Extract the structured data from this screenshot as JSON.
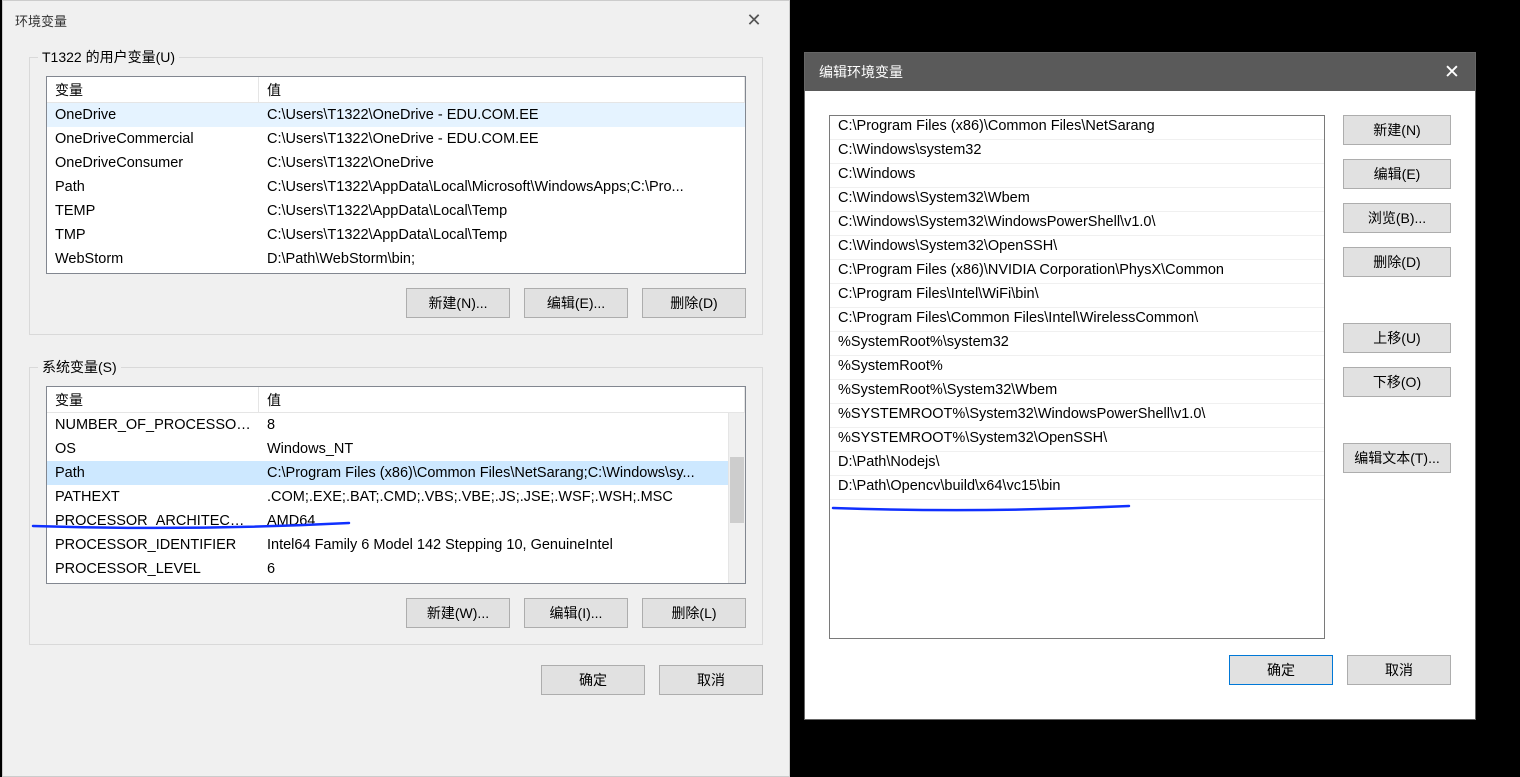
{
  "left": {
    "title": "环境变量",
    "userGroup": "T1322 的用户变量(U)",
    "sysGroup": "系统变量(S)",
    "headers": {
      "name": "变量",
      "value": "值"
    },
    "userVars": [
      {
        "name": "OneDrive",
        "value": "C:\\Users\\T1322\\OneDrive - EDU.COM.EE"
      },
      {
        "name": "OneDriveCommercial",
        "value": "C:\\Users\\T1322\\OneDrive - EDU.COM.EE"
      },
      {
        "name": "OneDriveConsumer",
        "value": "C:\\Users\\T1322\\OneDrive"
      },
      {
        "name": "Path",
        "value": "C:\\Users\\T1322\\AppData\\Local\\Microsoft\\WindowsApps;C:\\Pro..."
      },
      {
        "name": "TEMP",
        "value": "C:\\Users\\T1322\\AppData\\Local\\Temp"
      },
      {
        "name": "TMP",
        "value": "C:\\Users\\T1322\\AppData\\Local\\Temp"
      },
      {
        "name": "WebStorm",
        "value": "D:\\Path\\WebStorm\\bin;"
      }
    ],
    "sysVars": [
      {
        "name": "NUMBER_OF_PROCESSORS",
        "value": "8"
      },
      {
        "name": "OS",
        "value": "Windows_NT"
      },
      {
        "name": "Path",
        "value": "C:\\Program Files (x86)\\Common Files\\NetSarang;C:\\Windows\\sy..."
      },
      {
        "name": "PATHEXT",
        "value": ".COM;.EXE;.BAT;.CMD;.VBS;.VBE;.JS;.JSE;.WSF;.WSH;.MSC"
      },
      {
        "name": "PROCESSOR_ARCHITECTURE",
        "value": "AMD64"
      },
      {
        "name": "PROCESSOR_IDENTIFIER",
        "value": "Intel64 Family 6 Model 142 Stepping 10, GenuineIntel"
      },
      {
        "name": "PROCESSOR_LEVEL",
        "value": "6"
      }
    ],
    "selectedSysIndex": 2,
    "buttons": {
      "newUser": "新建(N)...",
      "editUser": "编辑(E)...",
      "deleteUser": "删除(D)",
      "newSys": "新建(W)...",
      "editSys": "编辑(I)...",
      "deleteSys": "删除(L)",
      "ok": "确定",
      "cancel": "取消"
    }
  },
  "right": {
    "title": "编辑环境变量",
    "paths": [
      "C:\\Program Files (x86)\\Common Files\\NetSarang",
      "C:\\Windows\\system32",
      "C:\\Windows",
      "C:\\Windows\\System32\\Wbem",
      "C:\\Windows\\System32\\WindowsPowerShell\\v1.0\\",
      "C:\\Windows\\System32\\OpenSSH\\",
      "C:\\Program Files (x86)\\NVIDIA Corporation\\PhysX\\Common",
      "C:\\Program Files\\Intel\\WiFi\\bin\\",
      "C:\\Program Files\\Common Files\\Intel\\WirelessCommon\\",
      "%SystemRoot%\\system32",
      "%SystemRoot%",
      "%SystemRoot%\\System32\\Wbem",
      "%SYSTEMROOT%\\System32\\WindowsPowerShell\\v1.0\\",
      "%SYSTEMROOT%\\System32\\OpenSSH\\",
      "D:\\Path\\Nodejs\\",
      "D:\\Path\\Opencv\\build\\x64\\vc15\\bin"
    ],
    "buttons": {
      "new": "新建(N)",
      "edit": "编辑(E)",
      "browse": "浏览(B)...",
      "delete": "删除(D)",
      "moveUp": "上移(U)",
      "moveDown": "下移(O)",
      "editText": "编辑文本(T)...",
      "ok": "确定",
      "cancel": "取消"
    }
  }
}
